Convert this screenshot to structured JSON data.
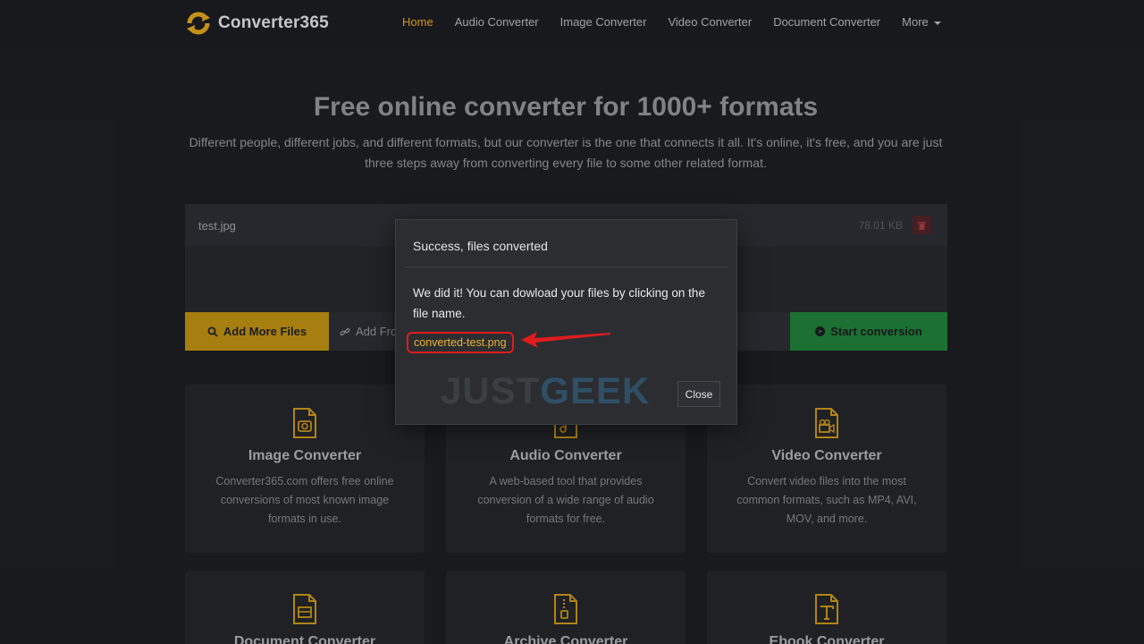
{
  "brand": {
    "name": "Converter365",
    "accent": "#e0a528"
  },
  "nav": {
    "items": [
      "Home",
      "Audio Converter",
      "Image Converter",
      "Video Converter",
      "Document Converter"
    ],
    "more_label": "More"
  },
  "hero": {
    "title": "Free online converter for 1000+ formats",
    "subtitle": "Different people, different jobs, and different formats, but our converter is the one that connects it all. It's online, it's free, and you are just three steps away from converting every file to some other related format."
  },
  "upload": {
    "file_name": "test.jpg",
    "file_size": "78.01 KB",
    "add_more_label": "Add More Files",
    "add_from_label": "Add Fro",
    "start_label": "Start conversion"
  },
  "cards": [
    {
      "title": "Image Converter",
      "desc": "Converter365.com offers free online conversions of most known image formats in use."
    },
    {
      "title": "Audio Converter",
      "desc": "A web-based tool that provides conversion of a wide range of audio formats for free."
    },
    {
      "title": "Video Converter",
      "desc": "Convert video files into the most common formats, such as MP4, AVI, MOV, and more."
    },
    {
      "title": "Document Converter"
    },
    {
      "title": "Archive Converter"
    },
    {
      "title": "Ebook Converter"
    }
  ],
  "modal": {
    "title": "Success, files converted",
    "body": "We did it! You can dowload your files by clicking on the file name.",
    "file_link": "converted-test.png",
    "close_label": "Close",
    "watermark_part1": "JUST",
    "watermark_part2": "GEEK"
  }
}
